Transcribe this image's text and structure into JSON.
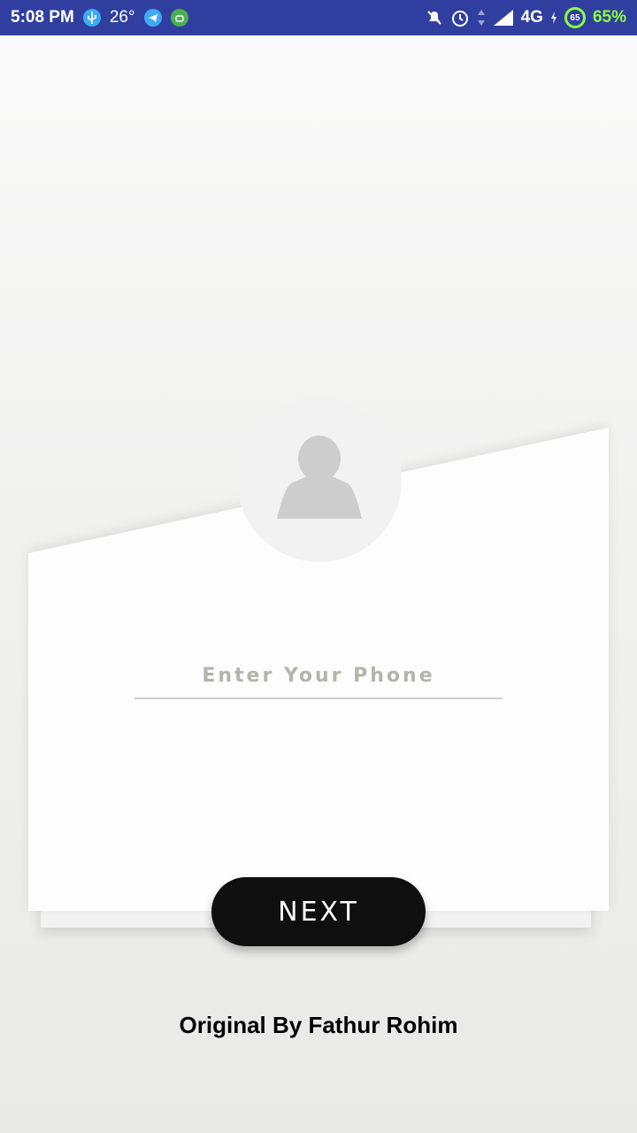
{
  "status_bar": {
    "time": "5:08 PM",
    "temperature": "26°",
    "network": "4G",
    "battery_ring": "65",
    "battery_percent": "65%",
    "icons": [
      "usb-icon",
      "telegram-icon",
      "android-icon",
      "mute-icon",
      "alarm-icon",
      "data-arrows-icon",
      "signal-icon",
      "charging-icon"
    ]
  },
  "form": {
    "phone_placeholder": "Enter Your Phone",
    "phone_value": "",
    "next_label": "NEXT"
  },
  "footer": {
    "credit": "Original By Fathur Rohim"
  },
  "colors": {
    "status_bar": "#303f9f",
    "button": "#0f0f0f",
    "battery": "#8bff3d"
  }
}
